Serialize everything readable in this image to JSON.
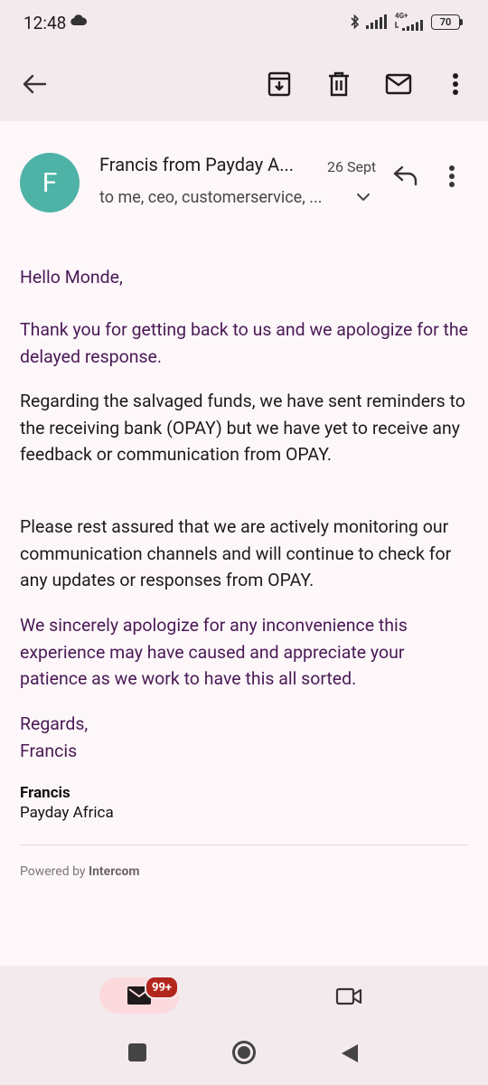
{
  "status_bar": {
    "time": "12:48",
    "network": "4G+",
    "battery": "70"
  },
  "toolbar": {
    "back": "back",
    "archive": "archive",
    "delete": "delete",
    "mark_unread": "mark unread",
    "more": "more options"
  },
  "email": {
    "avatar_letter": "F",
    "sender": "Francis from Payday A...",
    "date": "26 Sept",
    "recipients": "to me, ceo, customerservice, ...",
    "paragraphs": [
      "Hello Monde,",
      "Thank you for getting back to us and we apologize for the delayed response.",
      "Regarding the salvaged funds, we have sent reminders to the receiving bank (OPAY) but we have yet to receive any feedback or communication from OPAY.",
      "Please rest assured that we are actively monitoring our communication channels and will continue to check for any updates or responses from OPAY.",
      "We sincerely apologize for any inconvenience this experience may have caused and appreciate your patience as we work to have this all sorted.",
      "Regards,",
      "Francis"
    ],
    "signature_name": "Francis",
    "signature_company": "Payday Africa",
    "powered_prefix": "Powered by ",
    "powered_brand": "Intercom"
  },
  "bottom_nav": {
    "mail_badge": "99+"
  },
  "colors": {
    "avatar": "#4eb3a6",
    "purple_text": "#4a1a55",
    "badge": "#b3261e",
    "active_tab": "#fcd9dc"
  }
}
